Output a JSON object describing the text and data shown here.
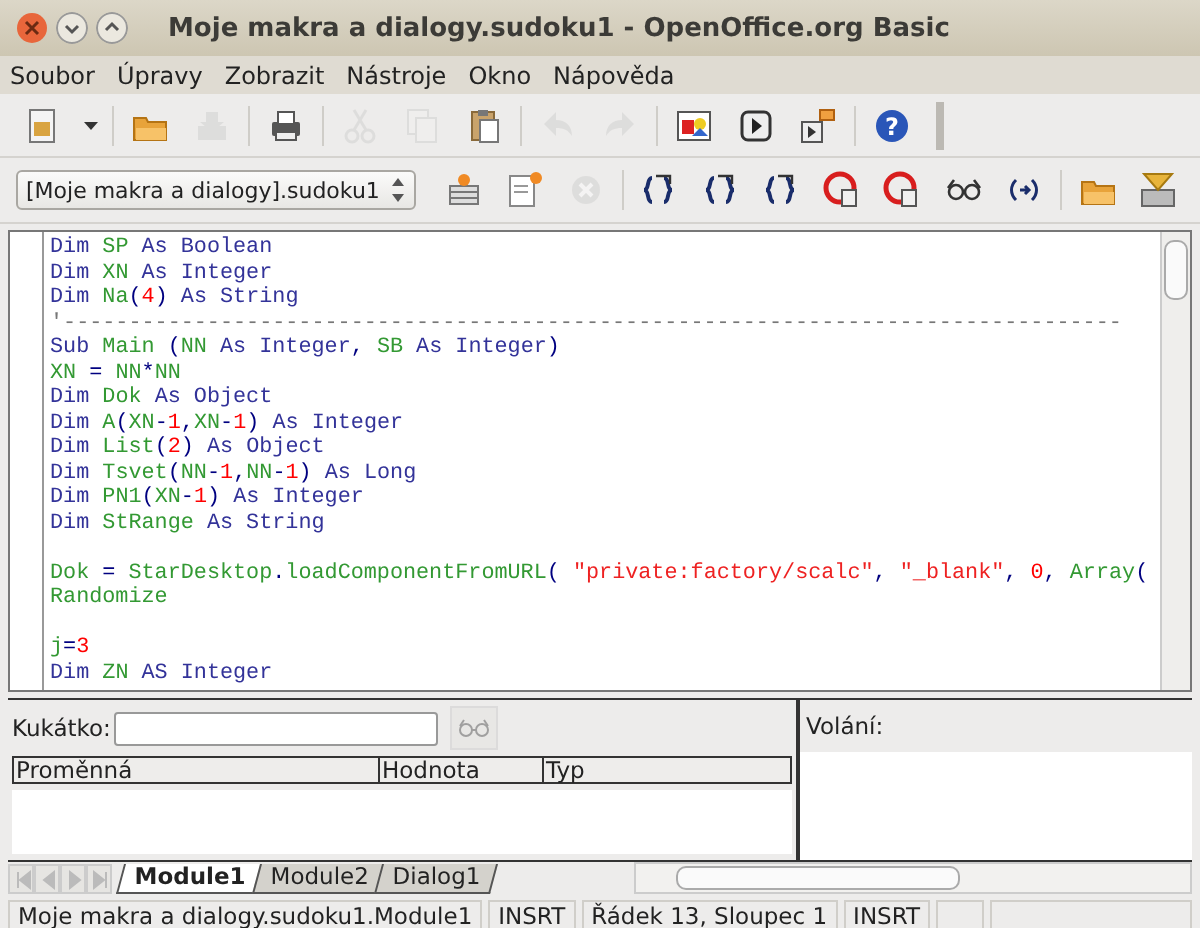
{
  "window": {
    "title": "Moje makra a dialogy.sudoku1 - OpenOffice.org Basic"
  },
  "menu": [
    {
      "label": "Soubor"
    },
    {
      "label": "Úpravy"
    },
    {
      "label": "Zobrazit"
    },
    {
      "label": "Nástroje"
    },
    {
      "label": "Okno"
    },
    {
      "label": "Nápověda"
    }
  ],
  "toolbar": [
    {
      "kind": "new",
      "disabled": false
    },
    {
      "kind": "caret",
      "disabled": false
    },
    {
      "kind": "sep"
    },
    {
      "kind": "open",
      "disabled": false
    },
    {
      "kind": "save",
      "disabled": true
    },
    {
      "kind": "sep"
    },
    {
      "kind": "print",
      "disabled": false
    },
    {
      "kind": "sep"
    },
    {
      "kind": "cut",
      "disabled": true
    },
    {
      "kind": "copy",
      "disabled": true
    },
    {
      "kind": "paste",
      "disabled": false
    },
    {
      "kind": "sep"
    },
    {
      "kind": "undo",
      "disabled": true
    },
    {
      "kind": "redo",
      "disabled": true
    },
    {
      "kind": "sep"
    },
    {
      "kind": "picture",
      "disabled": false
    },
    {
      "kind": "run",
      "disabled": false
    },
    {
      "kind": "export",
      "disabled": false
    },
    {
      "kind": "sep"
    },
    {
      "kind": "help",
      "glyph": "?",
      "disabled": false
    }
  ],
  "library": {
    "value": "[Moje makra a dialogy].sudoku1"
  },
  "macro_toolbar": [
    {
      "kind": "stack",
      "disabled": false
    },
    {
      "kind": "newdoc",
      "disabled": false
    },
    {
      "kind": "stop",
      "disabled": true
    },
    {
      "kind": "sep"
    },
    {
      "kind": "braces",
      "disabled": false
    },
    {
      "kind": "braces",
      "disabled": false
    },
    {
      "kind": "braces",
      "disabled": false
    },
    {
      "kind": "ring",
      "disabled": false
    },
    {
      "kind": "ring",
      "disabled": false
    },
    {
      "kind": "glasses",
      "disabled": false
    },
    {
      "kind": "arrows",
      "disabled": false
    },
    {
      "kind": "sep"
    },
    {
      "kind": "open",
      "disabled": false
    },
    {
      "kind": "import",
      "disabled": false
    }
  ],
  "code": [
    {
      "kind": "code",
      "tokens": [
        {
          "kind": "keyword",
          "t": "Dim "
        },
        {
          "kind": "name",
          "t": "SP "
        },
        {
          "kind": "keyword",
          "t": "As Boolean"
        }
      ]
    },
    {
      "kind": "code",
      "tokens": [
        {
          "kind": "keyword",
          "t": "Dim "
        },
        {
          "kind": "name",
          "t": "XN "
        },
        {
          "kind": "keyword",
          "t": "As Integer"
        }
      ]
    },
    {
      "kind": "code",
      "tokens": [
        {
          "kind": "keyword",
          "t": "Dim "
        },
        {
          "kind": "name",
          "t": "Na"
        },
        {
          "kind": "operator",
          "t": "("
        },
        {
          "kind": "number",
          "t": "4"
        },
        {
          "kind": "operator",
          "t": ") "
        },
        {
          "kind": "keyword",
          "t": "As String"
        }
      ]
    },
    {
      "kind": "code",
      "tokens": [
        {
          "kind": "comment",
          "t": "'---------------------------------------------------------------------------------"
        }
      ]
    },
    {
      "kind": "code",
      "tokens": [
        {
          "kind": "keyword",
          "t": "Sub "
        },
        {
          "kind": "name",
          "t": "Main "
        },
        {
          "kind": "operator",
          "t": "("
        },
        {
          "kind": "name",
          "t": "NN "
        },
        {
          "kind": "keyword",
          "t": "As Integer"
        },
        {
          "kind": "operator",
          "t": ", "
        },
        {
          "kind": "name",
          "t": "SB "
        },
        {
          "kind": "keyword",
          "t": "As Integer"
        },
        {
          "kind": "operator",
          "t": ")"
        }
      ]
    },
    {
      "kind": "code",
      "tokens": [
        {
          "kind": "name",
          "t": "XN "
        },
        {
          "kind": "operator",
          "t": "= "
        },
        {
          "kind": "name",
          "t": "NN"
        },
        {
          "kind": "operator",
          "t": "*"
        },
        {
          "kind": "name",
          "t": "NN"
        }
      ]
    },
    {
      "kind": "code",
      "tokens": [
        {
          "kind": "keyword",
          "t": "Dim "
        },
        {
          "kind": "name",
          "t": "Dok "
        },
        {
          "kind": "keyword",
          "t": "As Object"
        }
      ]
    },
    {
      "kind": "code",
      "tokens": [
        {
          "kind": "keyword",
          "t": "Dim "
        },
        {
          "kind": "name",
          "t": "A"
        },
        {
          "kind": "operator",
          "t": "("
        },
        {
          "kind": "name",
          "t": "XN"
        },
        {
          "kind": "operator",
          "t": "-"
        },
        {
          "kind": "number",
          "t": "1"
        },
        {
          "kind": "operator",
          "t": ","
        },
        {
          "kind": "name",
          "t": "XN"
        },
        {
          "kind": "operator",
          "t": "-"
        },
        {
          "kind": "number",
          "t": "1"
        },
        {
          "kind": "operator",
          "t": ") "
        },
        {
          "kind": "keyword",
          "t": "As Integer"
        }
      ]
    },
    {
      "kind": "code",
      "tokens": [
        {
          "kind": "keyword",
          "t": "Dim "
        },
        {
          "kind": "name",
          "t": "List"
        },
        {
          "kind": "operator",
          "t": "("
        },
        {
          "kind": "number",
          "t": "2"
        },
        {
          "kind": "operator",
          "t": ") "
        },
        {
          "kind": "keyword",
          "t": "As Object"
        }
      ]
    },
    {
      "kind": "code",
      "tokens": [
        {
          "kind": "keyword",
          "t": "Dim "
        },
        {
          "kind": "name",
          "t": "Tsvet"
        },
        {
          "kind": "operator",
          "t": "("
        },
        {
          "kind": "name",
          "t": "NN"
        },
        {
          "kind": "operator",
          "t": "-"
        },
        {
          "kind": "number",
          "t": "1"
        },
        {
          "kind": "operator",
          "t": ","
        },
        {
          "kind": "name",
          "t": "NN"
        },
        {
          "kind": "operator",
          "t": "-"
        },
        {
          "kind": "number",
          "t": "1"
        },
        {
          "kind": "operator",
          "t": ") "
        },
        {
          "kind": "keyword",
          "t": "As Long"
        }
      ]
    },
    {
      "kind": "code",
      "tokens": [
        {
          "kind": "keyword",
          "t": "Dim "
        },
        {
          "kind": "name",
          "t": "PN1"
        },
        {
          "kind": "operator",
          "t": "("
        },
        {
          "kind": "name",
          "t": "XN"
        },
        {
          "kind": "operator",
          "t": "-"
        },
        {
          "kind": "number",
          "t": "1"
        },
        {
          "kind": "operator",
          "t": ") "
        },
        {
          "kind": "keyword",
          "t": "As Integer"
        }
      ]
    },
    {
      "kind": "code",
      "tokens": [
        {
          "kind": "keyword",
          "t": "Dim "
        },
        {
          "kind": "name",
          "t": "StRange "
        },
        {
          "kind": "keyword",
          "t": "As String"
        }
      ]
    },
    {
      "kind": "blank"
    },
    {
      "kind": "code",
      "tokens": [
        {
          "kind": "name",
          "t": "Dok "
        },
        {
          "kind": "operator",
          "t": "= "
        },
        {
          "kind": "name",
          "t": "StarDesktop"
        },
        {
          "kind": "operator",
          "t": "."
        },
        {
          "kind": "name",
          "t": "loadComponentFromURL"
        },
        {
          "kind": "operator",
          "t": "( "
        },
        {
          "kind": "string",
          "t": "\"private:factory/scalc\""
        },
        {
          "kind": "operator",
          "t": ", "
        },
        {
          "kind": "string",
          "t": "\"_blank\""
        },
        {
          "kind": "operator",
          "t": ", "
        },
        {
          "kind": "number",
          "t": "0"
        },
        {
          "kind": "operator",
          "t": ", "
        },
        {
          "kind": "name",
          "t": "Array"
        },
        {
          "kind": "operator",
          "t": "("
        }
      ]
    },
    {
      "kind": "code",
      "tokens": [
        {
          "kind": "name",
          "t": "Randomize"
        }
      ]
    },
    {
      "kind": "blank"
    },
    {
      "kind": "code",
      "tokens": [
        {
          "kind": "name",
          "t": "j"
        },
        {
          "kind": "operator",
          "t": "="
        },
        {
          "kind": "number",
          "t": "3"
        }
      ]
    },
    {
      "kind": "code",
      "tokens": [
        {
          "kind": "keyword",
          "t": "Dim "
        },
        {
          "kind": "name",
          "t": "ZN "
        },
        {
          "kind": "keyword",
          "t": "AS Integer"
        }
      ]
    }
  ],
  "watch": {
    "label": "Kukátko:",
    "columns": [
      "Proměnná",
      "Hodnota",
      "Typ"
    ]
  },
  "calls": {
    "label": "Volání:"
  },
  "tabs": [
    {
      "label": "Module1",
      "selected": true
    },
    {
      "label": "Module2",
      "selected": false
    },
    {
      "label": "Dialog1",
      "selected": false
    }
  ],
  "status_bar": [
    "Moje makra a dialogy.sudoku1.Module1",
    "INSRT",
    "Řádek 13, Sloupec 1",
    "INSRT"
  ]
}
